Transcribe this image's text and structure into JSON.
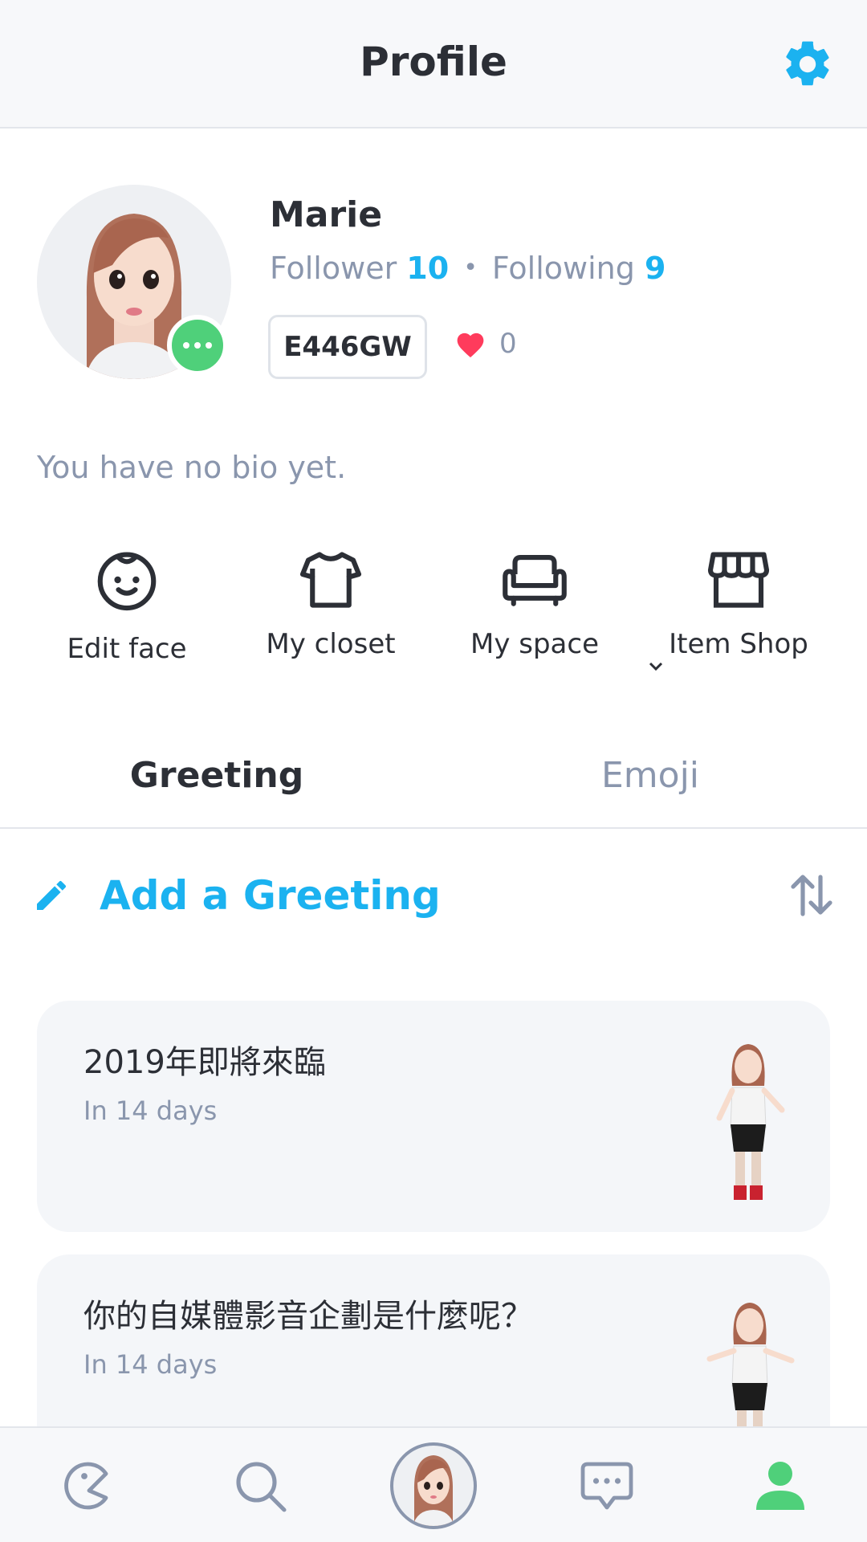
{
  "header": {
    "title": "Profile",
    "settings_icon": "gear-icon",
    "accent_color": "#1bb2f0"
  },
  "profile": {
    "name": "Marie",
    "follower_label": "Follower",
    "follower_count": "10",
    "following_label": "Following",
    "following_count": "9",
    "separator": "•",
    "user_code": "E446GW",
    "likes_count": "0",
    "bio": "You have no bio yet.",
    "status_color": "#4fd07a"
  },
  "actions": [
    {
      "label": "Edit face",
      "icon": "face-icon"
    },
    {
      "label": "My closet",
      "icon": "shirt-icon"
    },
    {
      "label": "My space",
      "icon": "sofa-icon"
    },
    {
      "label": "Item Shop",
      "icon": "shop-icon"
    }
  ],
  "tabs": [
    {
      "label": "Greeting",
      "active": true
    },
    {
      "label": "Emoji",
      "active": false
    }
  ],
  "greeting": {
    "add_label": "Add a Greeting",
    "add_icon": "pencil-icon",
    "sort_icon": "sort-icon"
  },
  "cards": [
    {
      "title": "2019年即將來臨",
      "subtitle": "In 14 days"
    },
    {
      "title": "你的自媒體影音企劃是什麼呢？",
      "subtitle": "In 14 days"
    }
  ],
  "bottom_nav": [
    {
      "name": "home",
      "icon": "pacman-icon"
    },
    {
      "name": "search",
      "icon": "search-icon"
    },
    {
      "name": "avatar",
      "icon": "avatar-icon"
    },
    {
      "name": "chat",
      "icon": "chat-icon"
    },
    {
      "name": "profile",
      "icon": "person-icon",
      "active": true
    }
  ]
}
